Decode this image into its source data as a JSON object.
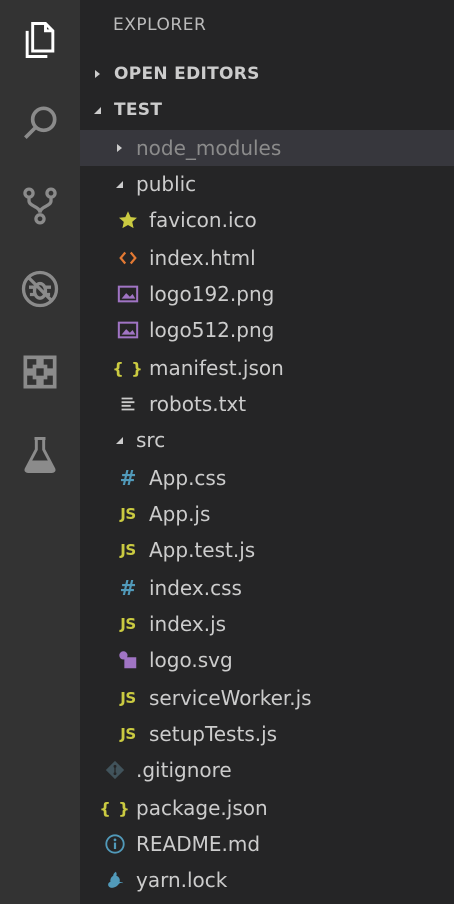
{
  "activity_bar": {
    "items": [
      {
        "name": "explorer-icon",
        "active": true
      },
      {
        "name": "search-icon",
        "active": false
      },
      {
        "name": "source-control-icon",
        "active": false
      },
      {
        "name": "debug-icon",
        "active": false
      },
      {
        "name": "extensions-icon",
        "active": false
      },
      {
        "name": "testing-icon",
        "active": false
      }
    ]
  },
  "sidebar": {
    "title": "EXPLORER",
    "sections": {
      "open_editors": {
        "label": "OPEN EDITORS",
        "expanded": false
      },
      "workspace": {
        "label": "TEST",
        "expanded": true
      }
    },
    "tree": [
      {
        "label": "node_modules",
        "type": "folder",
        "expanded": false,
        "depth": 1,
        "icon": "chevron-right-icon"
      },
      {
        "label": "public",
        "type": "folder",
        "expanded": true,
        "depth": 1,
        "icon": "chevron-down-icon"
      },
      {
        "label": "favicon.ico",
        "type": "file",
        "depth": 2,
        "icon": "star-icon"
      },
      {
        "label": "index.html",
        "type": "file",
        "depth": 2,
        "icon": "html-icon"
      },
      {
        "label": "logo192.png",
        "type": "file",
        "depth": 2,
        "icon": "image-icon"
      },
      {
        "label": "logo512.png",
        "type": "file",
        "depth": 2,
        "icon": "image-icon"
      },
      {
        "label": "manifest.json",
        "type": "file",
        "depth": 2,
        "icon": "json-icon"
      },
      {
        "label": "robots.txt",
        "type": "file",
        "depth": 2,
        "icon": "text-file-icon"
      },
      {
        "label": "src",
        "type": "folder",
        "expanded": true,
        "depth": 1,
        "icon": "chevron-down-icon"
      },
      {
        "label": "App.css",
        "type": "file",
        "depth": 2,
        "icon": "css-icon"
      },
      {
        "label": "App.js",
        "type": "file",
        "depth": 2,
        "icon": "js-icon"
      },
      {
        "label": "App.test.js",
        "type": "file",
        "depth": 2,
        "icon": "js-icon"
      },
      {
        "label": "index.css",
        "type": "file",
        "depth": 2,
        "icon": "css-icon"
      },
      {
        "label": "index.js",
        "type": "file",
        "depth": 2,
        "icon": "js-icon"
      },
      {
        "label": "logo.svg",
        "type": "file",
        "depth": 2,
        "icon": "svg-icon"
      },
      {
        "label": "serviceWorker.js",
        "type": "file",
        "depth": 2,
        "icon": "js-icon"
      },
      {
        "label": "setupTests.js",
        "type": "file",
        "depth": 2,
        "icon": "js-icon"
      },
      {
        "label": ".gitignore",
        "type": "file",
        "depth": 1,
        "icon": "git-icon"
      },
      {
        "label": "package.json",
        "type": "file",
        "depth": 1,
        "icon": "json-icon"
      },
      {
        "label": "README.md",
        "type": "file",
        "depth": 1,
        "icon": "info-icon"
      },
      {
        "label": "yarn.lock",
        "type": "file",
        "depth": 1,
        "icon": "yarn-icon"
      }
    ],
    "badges": {
      "js": "JS",
      "css": "#",
      "json": "{ }"
    }
  },
  "colors": {
    "activity_bar_bg": "#333333",
    "sidebar_bg": "#252526",
    "selected_bg": "#37373d",
    "js_yellow": "#cbcb41",
    "css_blue": "#519aba",
    "html_orange": "#e37933",
    "image_purple": "#a074c4"
  }
}
